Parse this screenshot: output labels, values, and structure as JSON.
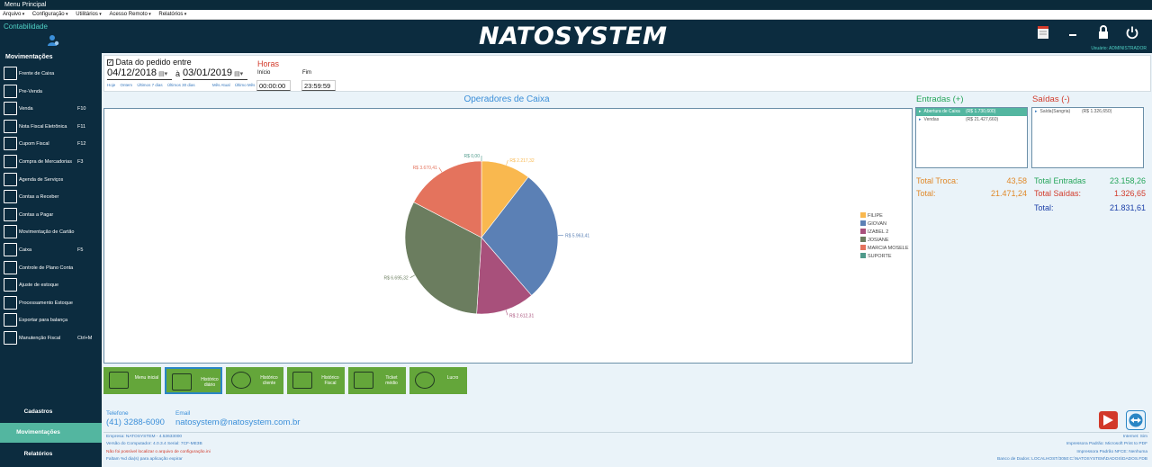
{
  "window": {
    "title": "Menu Principal"
  },
  "menu": [
    "Arquivo",
    "Configuração",
    "Utilitários",
    "Acesso Remoto",
    "Relatórios"
  ],
  "header": {
    "section": "Contabilidade",
    "logo": "NATOSYSTEM",
    "user_label": "Usuário: ADMINISTRADOR"
  },
  "sidebar": {
    "title": "Movimentações",
    "items": [
      {
        "label": "Frente de Caixa",
        "key": ""
      },
      {
        "label": "Pre-Venda",
        "key": ""
      },
      {
        "label": "Venda",
        "key": "F10"
      },
      {
        "label": "Nota Fiscal Eletrônica",
        "key": "F11"
      },
      {
        "label": "Cupom Fiscal",
        "key": "F12"
      },
      {
        "label": "Compra de Mercadorias",
        "key": "F3"
      },
      {
        "label": "Agenda de Serviços",
        "key": ""
      },
      {
        "label": "Contas a Receber",
        "key": ""
      },
      {
        "label": "Contas a Pagar",
        "key": ""
      },
      {
        "label": "Movimentação de Cartão",
        "key": ""
      },
      {
        "label": "Caixa",
        "key": "F5"
      },
      {
        "label": "Controle de Plano Conta",
        "key": ""
      },
      {
        "label": "Ajuste de estoque",
        "key": ""
      },
      {
        "label": "Processamento Estoque",
        "key": ""
      },
      {
        "label": "Exportar para balança",
        "key": ""
      },
      {
        "label": "Manutenção Fiscal",
        "key": "Ctrl+M"
      }
    ],
    "bottom": [
      "Cadastros",
      "Movimentações",
      "Relatórios"
    ]
  },
  "filter": {
    "checkbox_label": "Data do pedido entre",
    "checked": true,
    "date_from": "04/12/2018",
    "date_sep": "à",
    "date_to": "03/01/2019",
    "shortcuts_left": [
      "Hoje",
      "Ontem",
      "Últimos 7 dias",
      "Últimos 30 dias"
    ],
    "shortcuts_right": [
      "Mês Atual",
      "Último Mês"
    ],
    "hours_title": "Horas",
    "start_label": "Início",
    "end_label": "Fim",
    "start_time": "00:00:00",
    "end_time": "23:59:59"
  },
  "chart_data": {
    "type": "pie",
    "title": "Operadores de Caixa",
    "legend_position": "right",
    "slices": [
      {
        "name": "FILIPE",
        "label": "R$ 2.217,32",
        "color": "#f9b84f"
      },
      {
        "name": "GIOVAN",
        "label": "R$ 5.963,41",
        "color": "#5b80b5"
      },
      {
        "name": "IZABEL 2",
        "label": "R$ 2.612,31",
        "color": "#a8507b"
      },
      {
        "name": "JOSIANE",
        "label": "R$ 6.695,32",
        "color": "#6b7d5f"
      },
      {
        "name": "MARCIA MOSELE",
        "label": "R$ 3.670,41",
        "color": "#e4735d"
      },
      {
        "name": "SUPORTE",
        "label": "R$ 0,00",
        "color": "#4f9a8b"
      }
    ],
    "values": [
      2217.32,
      5963.41,
      2612.31,
      6695.32,
      3670.41,
      0
    ]
  },
  "entradas": {
    "title": "Entradas (+)",
    "rows": [
      {
        "label": "Abertura de Caixa",
        "value": "(R$ 1.730,600)"
      },
      {
        "label": "Vendas",
        "value": "(R$ 21.427,660)"
      }
    ]
  },
  "saidas": {
    "title": "Saídas (-)",
    "rows": [
      {
        "label": "Saída(Sangria)",
        "value": "(R$ 1.326,650)"
      }
    ]
  },
  "totals": {
    "troca_label": "Total Troca:",
    "troca_value": "43,58",
    "total_label": "Total:",
    "total_value": "21.471,24",
    "entradas_label": "Total Entradas",
    "entradas_value": "23.158,26",
    "saidas_label": "Total Saídas:",
    "saidas_value": "1.326,65",
    "grand_label": "Total:",
    "grand_value": "21.831,61"
  },
  "actions": [
    {
      "label": "Menu inicial",
      "icon": "book-icon"
    },
    {
      "label": "Histórico diário",
      "icon": "money-icon"
    },
    {
      "label": "Histórico cliente",
      "icon": "people-icon"
    },
    {
      "label": "Histórico Fiscal",
      "icon": "receipt-icon"
    },
    {
      "label": "Ticket médio",
      "icon": "ticket-icon"
    },
    {
      "label": "Lucro",
      "icon": "coin-icon"
    }
  ],
  "contact": {
    "phone_label": "Telefone",
    "phone": "(41) 3288-6090",
    "email_label": "Email",
    "email": "natosystem@natosystem.com.br"
  },
  "footer": {
    "left": [
      "Empresa: NATOSYSTEM - 4.53633000",
      "Versão do Computador: 4.0.3.4 Serial: 7CF-ME3B",
      "Não foi possível localizar o arquivo de configuração.ini",
      "Faltam %d dia(s) para aplicação expirar"
    ],
    "right": [
      "Internet: Sim",
      "Impressora Padrão: Microsoft Print to PDF",
      "Impressora Padrão NFCE: Nenhuma",
      "Banco de Dados: LOCALHOST/3050:C:\\NATOSYSTEM\\DADOS\\DADOS.FDB"
    ]
  }
}
